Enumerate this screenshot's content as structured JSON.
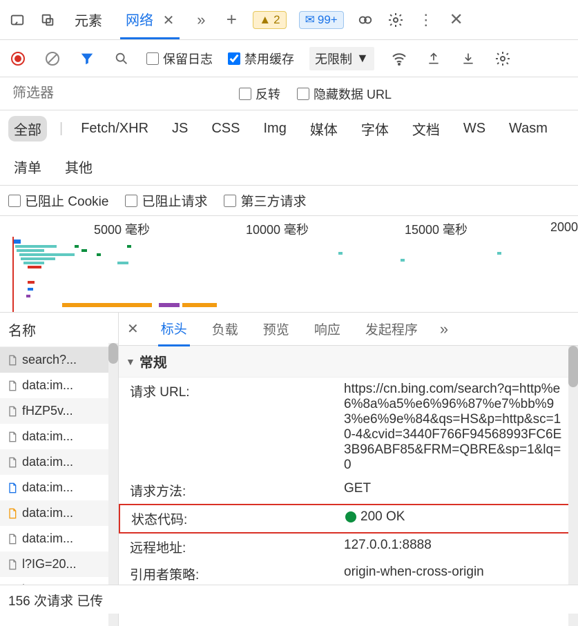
{
  "top_tabs": {
    "elements": "元素",
    "network": "网络",
    "warn_count": "2",
    "msg_count": "99+"
  },
  "network_toolbar": {
    "preserve_log": "保留日志",
    "disable_cache": "禁用缓存",
    "throttle": "无限制"
  },
  "filter_row": {
    "placeholder": "筛选器",
    "invert": "反转",
    "hide_data_url": "隐藏数据 URL"
  },
  "types": [
    "全部",
    "Fetch/XHR",
    "JS",
    "CSS",
    "Img",
    "媒体",
    "字体",
    "文档",
    "WS",
    "Wasm",
    "清单",
    "其他"
  ],
  "blocked_row": {
    "blocked_cookies": "已阻止 Cookie",
    "blocked_requests": "已阻止请求",
    "third_party": "第三方请求"
  },
  "timeline": {
    "ticks": [
      "5000 毫秒",
      "10000 毫秒",
      "15000 毫秒",
      "2000"
    ]
  },
  "name_panel": {
    "header": "名称",
    "items": [
      {
        "label": "search?...",
        "selected": true,
        "icon": "doc-lines"
      },
      {
        "label": "data:im...",
        "icon": "doc"
      },
      {
        "label": "fHZP5v...",
        "icon": "doc"
      },
      {
        "label": "data:im...",
        "icon": "doc"
      },
      {
        "label": "data:im...",
        "icon": "doc-alt"
      },
      {
        "label": "data:im...",
        "icon": "doc-web"
      },
      {
        "label": "data:im...",
        "icon": "doc-img"
      },
      {
        "label": "data:im...",
        "icon": "doc"
      },
      {
        "label": "l?IG=20...",
        "icon": "doc-lines"
      },
      {
        "label": "lsp.aspx",
        "icon": "doc"
      }
    ]
  },
  "detail_tabs": [
    "标头",
    "负载",
    "预览",
    "响应",
    "发起程序"
  ],
  "headers_section": {
    "general": "常规",
    "rows": [
      {
        "k": "请求 URL:",
        "v": "https://cn.bing.com/search?q=http%e6%8a%a5%e6%96%87%e7%bb%93%e6%9e%84&qs=HS&p=http&sc=10-4&cvid=3440F766F94568993FC6E3B96ABF85&FRM=QBRE&sp=1&lq=0"
      },
      {
        "k": "请求方法:",
        "v": "GET"
      },
      {
        "k": "状态代码:",
        "v": "200 OK",
        "status": true
      },
      {
        "k": "远程地址:",
        "v": "127.0.0.1:8888"
      },
      {
        "k": "引用者策略:",
        "v": "origin-when-cross-origin"
      }
    ]
  },
  "status_bar": "156 次请求  已传"
}
